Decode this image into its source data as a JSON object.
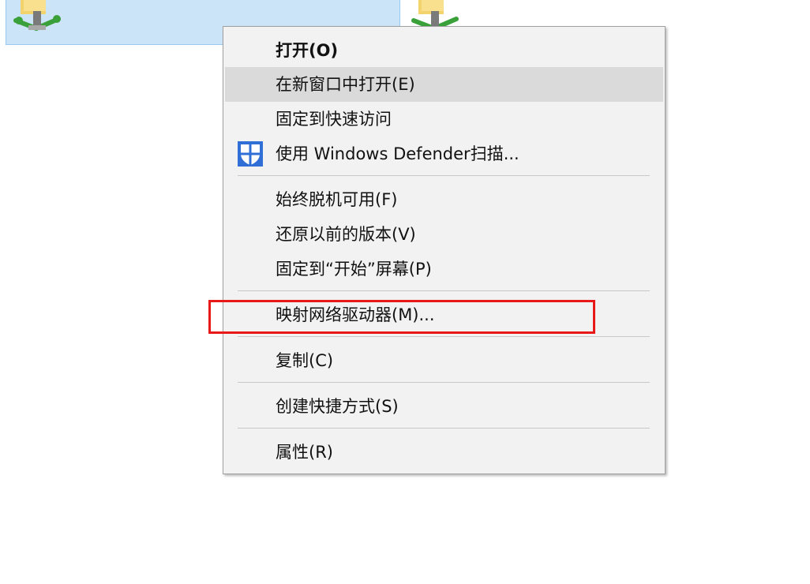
{
  "desktop": {
    "selection_color": "#cce4f7",
    "folder_icon": "network-folder-icon"
  },
  "context_menu": {
    "items": [
      {
        "label": "打开(O)",
        "bold": true
      },
      {
        "label": "在新窗口中打开(E)",
        "hovered": true
      },
      {
        "label": "固定到快速访问"
      },
      {
        "label": "使用 Windows Defender扫描...",
        "icon": "windows-defender-shield-icon"
      },
      {
        "label": "始终脱机可用(F)"
      },
      {
        "label": "还原以前的版本(V)"
      },
      {
        "label": "固定到“开始”屏幕(P)"
      },
      {
        "label": "映射网络驱动器(M)...",
        "annotated": true
      },
      {
        "label": "复制(C)"
      },
      {
        "label": "创建快捷方式(S)"
      },
      {
        "label": "属性(R)"
      }
    ],
    "annotation_color": "#e81919",
    "hover_color": "#dadada"
  }
}
